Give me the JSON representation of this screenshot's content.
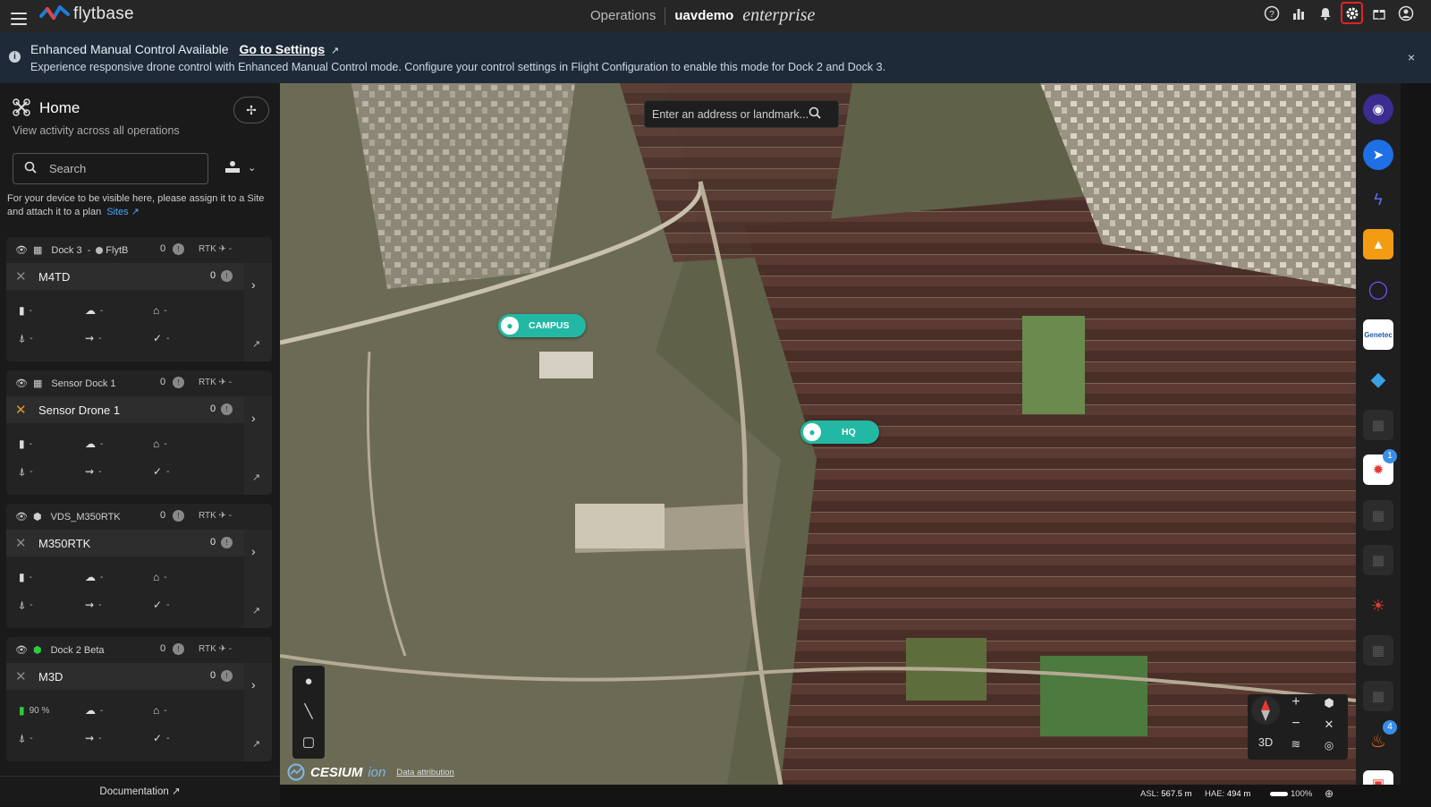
{
  "app": {
    "logo_text": "flytbase",
    "nav_label": "Operations",
    "org_name": "uavdemo",
    "edition": "enterprise"
  },
  "topbar_icons": [
    "help-icon",
    "analytics-icon",
    "bell-icon",
    "gear-icon",
    "gift-icon",
    "account-icon"
  ],
  "banner": {
    "title": "Enhanced Manual Control Available",
    "link": "Go to Settings",
    "text": "Experience responsive drone control with Enhanced Manual Control mode. Configure your control settings in Flight Configuration to enable this mode for Dock 2 and Dock 3.",
    "close": "×"
  },
  "sidebar": {
    "title": "Home",
    "subtitle": "View activity across all operations",
    "search_placeholder": "Search",
    "hint": "For your device to be visible here, please assign it to a Site and attach it to a plan",
    "hint_link": "Sites",
    "documentation": "Documentation"
  },
  "devices": [
    {
      "dock": "Dock 3",
      "sep": "-",
      "status": "FlytB",
      "count": "0",
      "rtk": "RTK",
      "rtk_val": "-",
      "drone": "M4TD",
      "drone_count": "0",
      "battery": "-",
      "weather": "-",
      "home": "-",
      "alt": "-",
      "speed": "-",
      "signal": "-"
    },
    {
      "dock": "Sensor Dock 1",
      "sep": "",
      "status": "",
      "count": "0",
      "rtk": "RTK",
      "rtk_val": "-",
      "drone": "Sensor Drone 1",
      "drone_count": "0",
      "battery": "-",
      "weather": "-",
      "home": "-",
      "alt": "-",
      "speed": "-",
      "signal": "-"
    },
    {
      "dock": "VDS_M350RTK",
      "sep": "",
      "status": "",
      "count": "0",
      "rtk": "RTK",
      "rtk_val": "-",
      "drone": "M350RTK",
      "drone_count": "0",
      "battery": "-",
      "weather": "-",
      "home": "-",
      "alt": "-",
      "speed": "-",
      "signal": "-"
    },
    {
      "dock": "Dock 2 Beta",
      "sep": "",
      "status": "",
      "count": "0",
      "rtk": "RTK",
      "rtk_val": "-",
      "drone": "M3D",
      "drone_count": "0",
      "battery": "90 %",
      "weather": "-",
      "home": "-",
      "alt": "-",
      "speed": "-",
      "signal": "-"
    }
  ],
  "map": {
    "search_placeholder": "Enter an address or landmark...",
    "markers": [
      {
        "label": "CAMPUS"
      },
      {
        "label": "HQ"
      }
    ],
    "view_mode": "3D",
    "attribution_brand": "CESIUM",
    "attribution_ion": "ion",
    "attribution_link": "Data attribution",
    "asl_label": "ASL:",
    "asl_value": "567.5 m",
    "hae_label": "HAE:",
    "hae_value": "494 m",
    "zoom": "100%",
    "zoom_fraction": 1.0
  },
  "right_rail": {
    "badges": {
      "alert": "1",
      "fire": "4"
    }
  },
  "colors": {
    "accent": "#22b8a4",
    "banner_bg": "#1e2a38",
    "highlight": "#e02424"
  }
}
